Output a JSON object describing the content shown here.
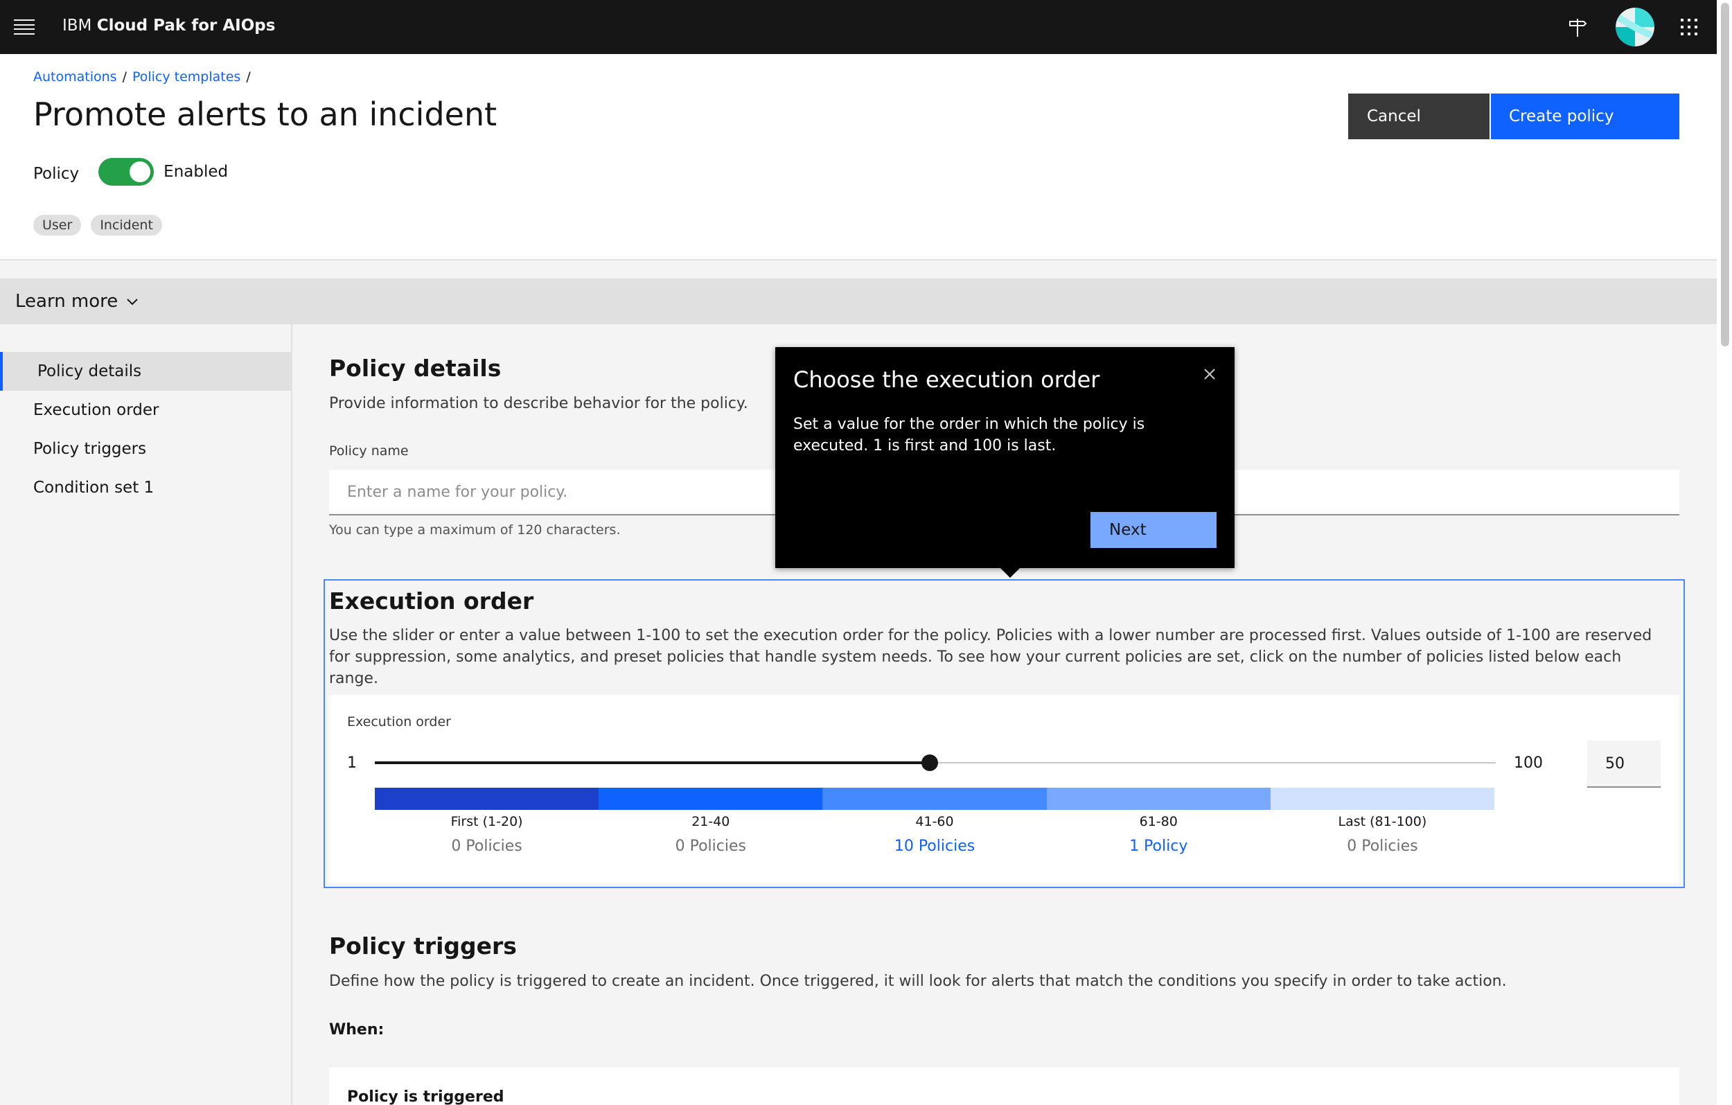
{
  "topbar": {
    "brand_prefix": "IBM",
    "brand_name": "Cloud Pak for AIOps"
  },
  "breadcrumb": {
    "items": [
      "Automations",
      "Policy templates"
    ],
    "separator": "/"
  },
  "page": {
    "title": "Promote alerts to an incident",
    "policy_label": "Policy",
    "toggle_state": "Enabled",
    "tags": [
      "User",
      "Incident"
    ]
  },
  "actions": {
    "cancel": "Cancel",
    "create": "Create policy"
  },
  "learn_more": "Learn more",
  "sidebar": {
    "items": [
      "Policy details",
      "Execution order",
      "Policy triggers",
      "Condition set 1"
    ]
  },
  "policy_details": {
    "title": "Policy details",
    "description": "Provide information to describe behavior for the policy.",
    "name_label": "Policy name",
    "name_placeholder": "Enter a name for your policy.",
    "helper": "You can type a maximum of 120 characters."
  },
  "execution_order": {
    "title": "Execution order",
    "description": "Use the slider or enter a value between 1-100 to set the execution order for the policy. Policies with a lower number are processed first. Values outside of 1-100 are reserved for suppression, some analytics, and preset policies that handle system needs. To see how your current policies are set, click on the number of policies listed below each range.",
    "slider_label": "Execution order",
    "min": "1",
    "max": "100",
    "value": "50",
    "value_fraction": 0.495,
    "ranges": [
      {
        "label": "First (1-20)",
        "count": "0 Policies",
        "color": "#1c3fcc"
      },
      {
        "label": "21-40",
        "count": "0 Policies",
        "color": "#0f62fe"
      },
      {
        "label": "41-60",
        "count": "10 Policies",
        "color": "#4589ff"
      },
      {
        "label": "61-80",
        "count": "1 Policy",
        "color": "#78a9ff"
      },
      {
        "label": "Last (81-100)",
        "count": "0 Policies",
        "color": "#d0e2ff"
      }
    ]
  },
  "policy_triggers": {
    "title": "Policy triggers",
    "description": "Define how the policy is triggered to create an incident. Once triggered, it will look for alerts that match the conditions you specify in order to take action.",
    "when": "When:",
    "panel_title": "Policy is triggered"
  },
  "tooltip": {
    "title": "Choose the execution order",
    "body": "Set a value for the order in which the policy is executed. 1 is first and 100 is last.",
    "next": "Next"
  },
  "colors": {
    "primary": "#0f62fe",
    "toggle_on": "#24a148",
    "topbar": "#161616"
  }
}
